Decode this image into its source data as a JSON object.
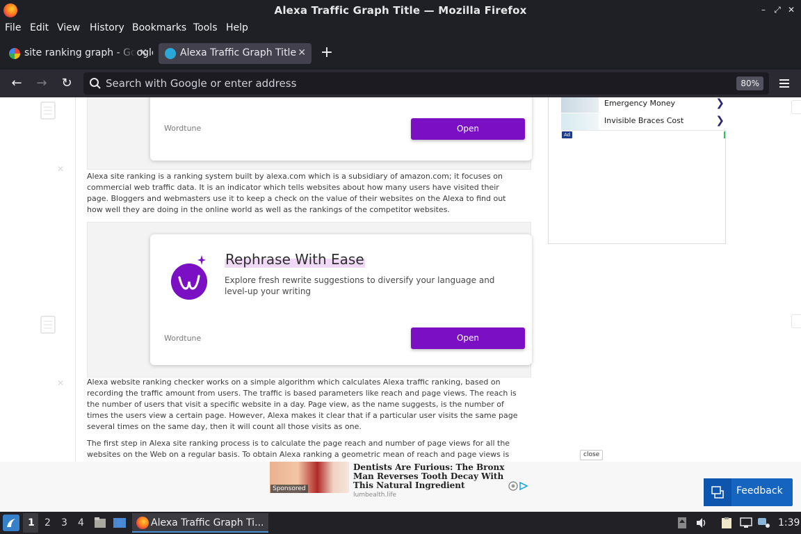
{
  "window": {
    "title": "Alexa Traffic Graph Title — Mozilla Firefox"
  },
  "menu": [
    "File",
    "Edit",
    "View",
    "History",
    "Bookmarks",
    "Tools",
    "Help"
  ],
  "tabs": [
    {
      "label": "site ranking graph - Google Search",
      "active": false
    },
    {
      "label": "Alexa Traffic Graph Title",
      "active": true
    }
  ],
  "urlbar": {
    "placeholder": "Search with Google or enter address",
    "zoom": "80%"
  },
  "right_ad": {
    "items": [
      {
        "label": "Emergency Money"
      },
      {
        "label": "Invisible Braces Cost"
      }
    ],
    "tag": "Ad"
  },
  "article": {
    "ad_top": {
      "brand": "Wordtune",
      "button": "Open"
    },
    "para1": "Alexa site ranking is a ranking system built by alexa.com which is a subsidiary of amazon.com; it focuses on commercial web traffic data. It is an indicator which tells websites about how many users have visited their page. Bloggers and webmasters use it to keep a check on the value of their websites on the Alexa to find out how well they are doing in the online world as well as the rankings of the competitor websites.",
    "ad_main": {
      "title": "Rephrase With Ease",
      "description": "Explore fresh rewrite suggestions to diversify your language and level-up your writing",
      "brand": "Wordtune",
      "button": "Open"
    },
    "para2": "Alexa website ranking checker works on a simple algorithm which calculates Alexa traffic ranking, based on recording the traffic amount from users. The traffic is based parameters like reach and page views. The reach is the number of users that visit a specific website in a day. Page view, as the name suggests, is the number of times the users view a certain page. However, Alexa makes it clear that if a particular user visits the same page several times on the same day, then it will count all those visits as one.",
    "para3": "The first step in Alexa site ranking process is to calculate the page reach and number of page views for all the websites on the Web on a regular basis. To obtain Alexa ranking a geometric mean of reach and page views is"
  },
  "bottom_ad": {
    "close": "close",
    "sponsored": "Sponsored",
    "headline": "Dentists Are Furious: The Bronx Man Reverses Tooth Decay With This Natural Ingredient",
    "source": "lumbealth.life"
  },
  "feedback": {
    "label": "Feedback"
  },
  "taskbar": {
    "workspaces": [
      "1",
      "2",
      "3",
      "4"
    ],
    "task_label": "Alexa Traffic Graph Ti...",
    "clock": "1:39"
  },
  "colors": {
    "accent_purple": "#7a0fc4",
    "feedback_blue": "#1565c0",
    "chrome_dark": "#1f1f26"
  }
}
